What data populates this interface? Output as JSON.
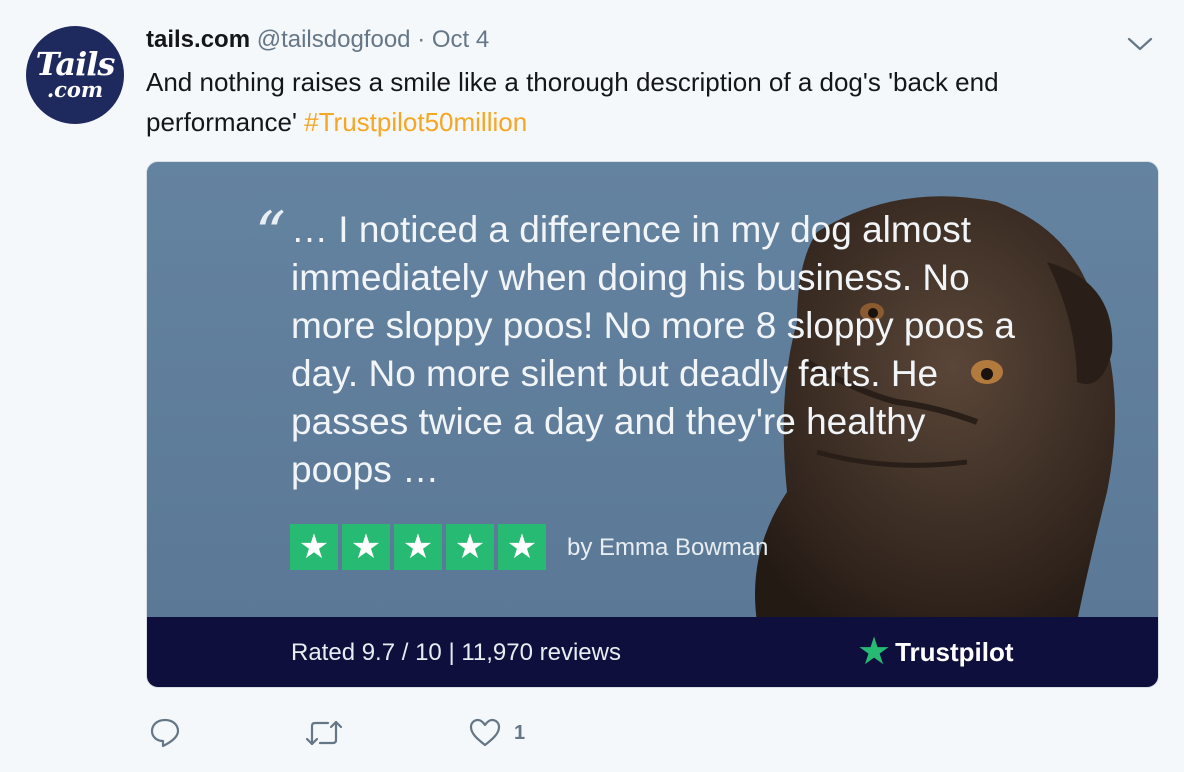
{
  "avatar": {
    "line1": "Tails",
    "line2": ".com"
  },
  "header": {
    "name": "tails.com",
    "handle": "@tailsdogfood",
    "separator": "·",
    "date": "Oct 4"
  },
  "tweet": {
    "text": "And nothing raises a smile like a thorough description of a dog's 'back end performance' ",
    "hashtag": "#Trustpilot50million"
  },
  "card": {
    "quote_mark": "“",
    "quote": "… I noticed a difference in my dog almost immediately when doing his business. No more sloppy poos! No more 8 sloppy poos a day. No more silent but deadly farts. He passes twice a day and they're healthy poops …",
    "rating_stars": 5,
    "byline": "by Emma Bowman",
    "rated_text": "Rated 9.7 / 10 | 11,970 reviews",
    "brand": "Trustpilot",
    "colors": {
      "star_green": "#27ba72",
      "footer_bg": "#0f0f3d",
      "card_bg": "#60809c"
    }
  },
  "actions": {
    "reply_icon": "reply-icon",
    "retweet_icon": "retweet-icon",
    "like_icon": "heart-icon",
    "like_count": "1"
  },
  "colors": {
    "hashtag": "#f5a623",
    "secondary_text": "#657786"
  }
}
